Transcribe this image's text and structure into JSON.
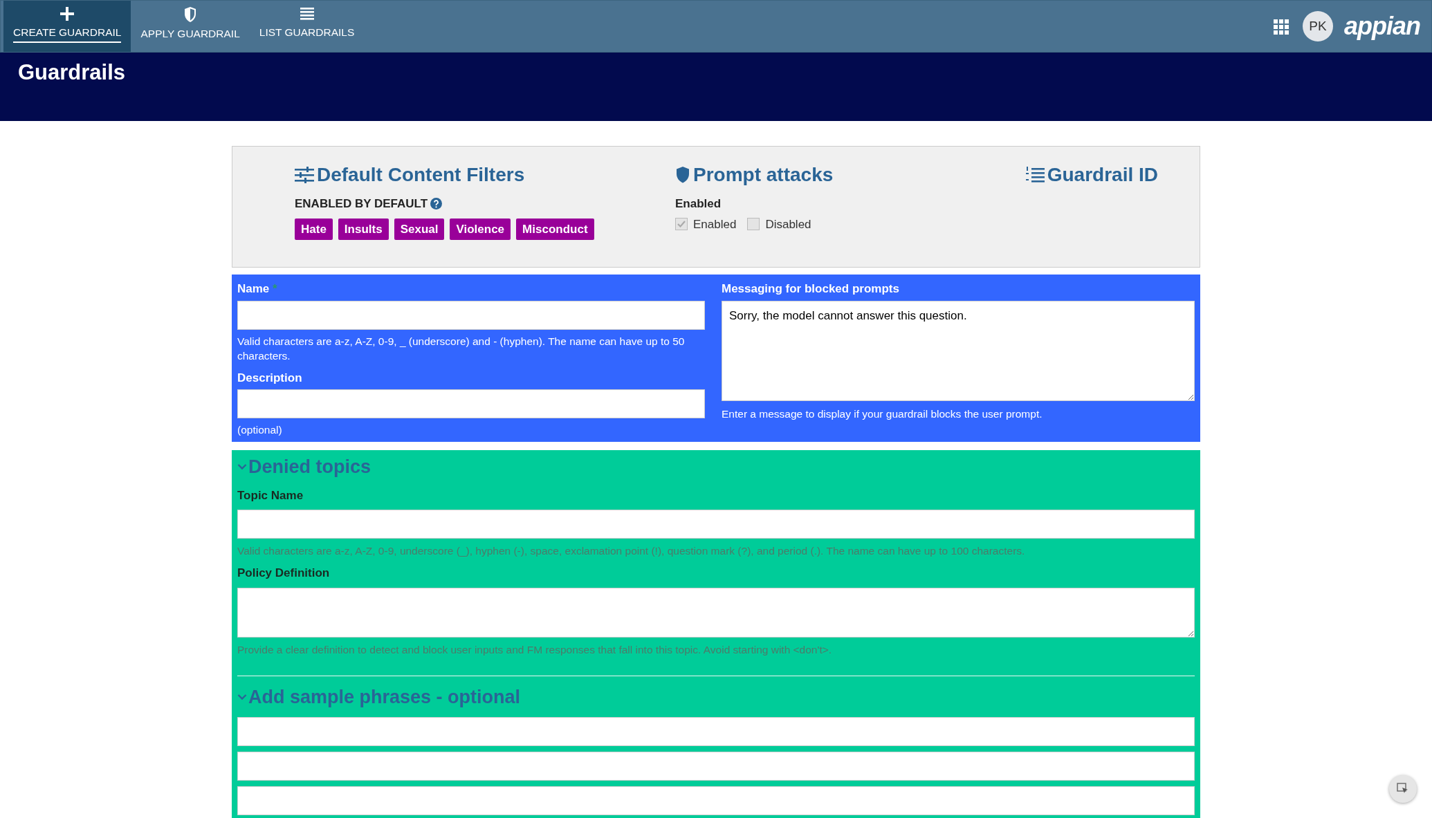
{
  "nav_tabs": [
    {
      "label": "CREATE GUARDRAIL",
      "kind": "create",
      "selected": true
    },
    {
      "label": "APPLY GUARDRAIL",
      "kind": "apply",
      "selected": false
    },
    {
      "label": "LIST GUARDRAILS",
      "kind": "list",
      "selected": false
    }
  ],
  "user": {
    "initials": "PK"
  },
  "logo": {
    "text": "appian"
  },
  "page_title": "Guardrails",
  "summary": {
    "filters": {
      "title": "Default Content Filters",
      "label": "ENABLED BY DEFAULT",
      "tags": [
        "Hate",
        "Insults",
        "Sexual",
        "Violence",
        "Misconduct"
      ]
    },
    "prompt_attacks": {
      "title": "Prompt attacks",
      "label": "Enabled",
      "options": [
        {
          "label": "Enabled",
          "checked": true
        },
        {
          "label": "Disabled",
          "checked": false
        }
      ]
    },
    "guardrail_id": {
      "title": "Guardrail ID"
    }
  },
  "details": {
    "name": {
      "label": "Name",
      "required_mark": "*",
      "help": "Valid characters are a-z, A-Z, 0-9, _ (underscore) and - (hyphen). The name can have up to 50 characters."
    },
    "description": {
      "label": "Description",
      "help": "(optional)"
    },
    "messaging": {
      "label": "Messaging for blocked prompts",
      "value": "Sorry, the model cannot answer this question.",
      "help": "Enter a message to display if your guardrail blocks the user prompt."
    }
  },
  "denied_topics": {
    "title": "Denied topics",
    "expanded": true,
    "topic_name": {
      "label": "Topic Name",
      "help": "Valid characters are a-z, A-Z, 0-9, underscore (_), hyphen (-), space, exclamation point (!), question mark (?), and period (.). The name can have up to 100 characters."
    },
    "policy_definition": {
      "label": "Policy Definition",
      "help": "Provide a clear definition to detect and block user inputs and FM responses that fall into this topic. Avoid starting with <don't>."
    },
    "sample_phrases": {
      "title": "Add sample phrases - optional",
      "expanded": true
    }
  }
}
